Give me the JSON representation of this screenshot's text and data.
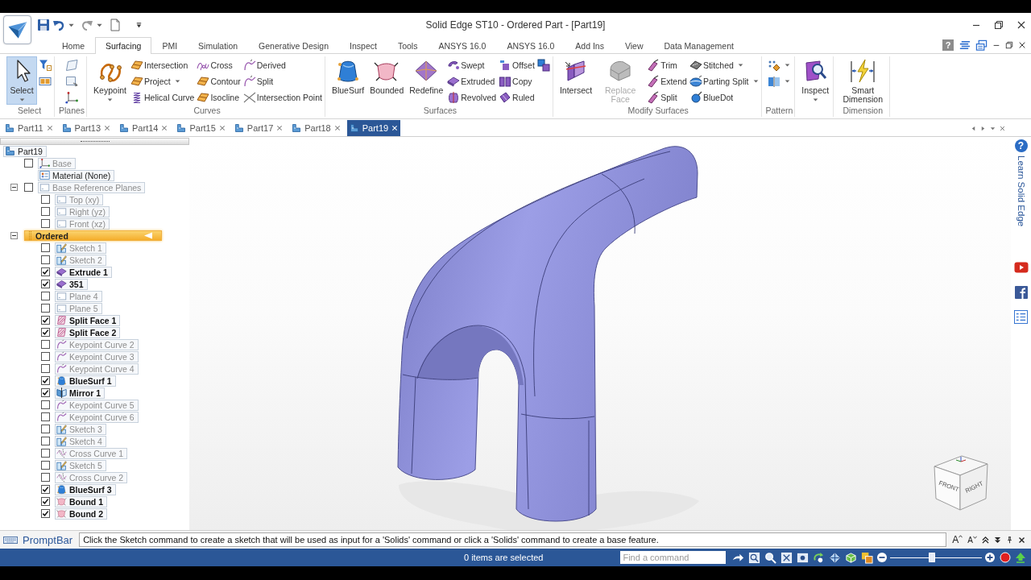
{
  "window": {
    "title": "Solid Edge ST10 - Ordered Part - [Part19]"
  },
  "ribbon": {
    "tabs": [
      {
        "label": "Home",
        "selected": false
      },
      {
        "label": "Surfacing",
        "selected": true
      },
      {
        "label": "PMI",
        "selected": false
      },
      {
        "label": "Simulation",
        "selected": false
      },
      {
        "label": "Generative Design",
        "selected": false
      },
      {
        "label": "Inspect",
        "selected": false
      },
      {
        "label": "Tools",
        "selected": false
      },
      {
        "label": "ANSYS 16.0",
        "selected": false
      },
      {
        "label": "ANSYS 16.0",
        "selected": false
      },
      {
        "label": "Add Ins",
        "selected": false
      },
      {
        "label": "View",
        "selected": false
      },
      {
        "label": "Data Management",
        "selected": false
      }
    ],
    "help_button": "?",
    "groups": [
      {
        "label": "Select",
        "large": [
          {
            "label": "Select",
            "pressed": true,
            "disabled": false,
            "dropdown": true
          }
        ],
        "columns": [
          [
            {
              "dropdown": false
            },
            {
              "dropdown": false
            }
          ]
        ]
      },
      {
        "label": "Planes",
        "columns": [
          [
            {
              "dropdown": false
            },
            {
              "dropdown": false
            },
            {
              "dropdown": false
            }
          ]
        ]
      },
      {
        "label": "Curves",
        "large": [
          {
            "label": "Keypoint",
            "pressed": false,
            "disabled": false,
            "dropdown": true
          }
        ],
        "columns": [
          [
            {
              "label": "Intersection",
              "dropdown": false
            },
            {
              "label": "Project",
              "dropdown": true
            },
            {
              "label": "Helical Curve",
              "dropdown": false
            }
          ],
          [
            {
              "label": "Cross",
              "dropdown": false
            },
            {
              "label": "Contour",
              "dropdown": false
            },
            {
              "label": "Isocline",
              "dropdown": false
            }
          ],
          [
            {
              "label": "Derived",
              "dropdown": false
            },
            {
              "label": "Split",
              "dropdown": false
            },
            {
              "label": "Intersection Point",
              "dropdown": false
            }
          ]
        ]
      },
      {
        "label": "Surfaces",
        "large": [
          {
            "label": "BlueSurf",
            "pressed": false,
            "disabled": false,
            "dropdown": false
          },
          {
            "label": "Bounded",
            "pressed": false,
            "disabled": false,
            "dropdown": false
          },
          {
            "label": "Redefine",
            "pressed": false,
            "disabled": false,
            "dropdown": false
          }
        ],
        "columns": [
          [
            {
              "label": "Swept",
              "dropdown": false
            },
            {
              "label": "Extruded",
              "dropdown": false
            },
            {
              "label": "Revolved",
              "dropdown": false
            }
          ],
          [
            {
              "label": "Offset",
              "dropdown": false
            },
            {
              "label": "Copy",
              "dropdown": false
            },
            {
              "label": "Ruled",
              "dropdown": false
            }
          ],
          [
            {
              "dropdown": false
            }
          ]
        ]
      },
      {
        "label": "Modify Surfaces",
        "large": [
          {
            "label": "Intersect",
            "pressed": false,
            "disabled": false,
            "dropdown": false
          },
          {
            "label": "Replace Face",
            "pressed": false,
            "disabled": true,
            "dropdown": false
          }
        ],
        "columns": [
          [
            {
              "label": "Trim",
              "dropdown": false
            },
            {
              "label": "Extend",
              "dropdown": false
            },
            {
              "label": "Split",
              "dropdown": false
            }
          ],
          [
            {
              "label": "Stitched",
              "dropdown": true
            },
            {
              "label": "Parting Split",
              "dropdown": true
            },
            {
              "label": "BlueDot",
              "dropdown": false
            }
          ]
        ]
      },
      {
        "label": "Pattern",
        "columns": [
          [
            {
              "dropdown": true
            },
            {
              "dropdown": true
            }
          ]
        ]
      },
      {
        "large": [
          {
            "label": "Inspect",
            "pressed": false,
            "disabled": false,
            "dropdown": true
          }
        ]
      },
      {
        "label": "Dimension",
        "large": [
          {
            "label": "Smart Dimension",
            "pressed": false,
            "disabled": false,
            "dropdown": false
          }
        ]
      }
    ]
  },
  "documents": {
    "tabs": [
      {
        "label": "Part11",
        "selected": false
      },
      {
        "label": "Part13",
        "selected": false
      },
      {
        "label": "Part14",
        "selected": false
      },
      {
        "label": "Part15",
        "selected": false
      },
      {
        "label": "Part17",
        "selected": false
      },
      {
        "label": "Part18",
        "selected": false
      },
      {
        "label": "Part19",
        "selected": true
      }
    ]
  },
  "feature_tree": {
    "root": {
      "label": "Part19",
      "kind": "part",
      "children": [
        {
          "label": "Base",
          "kind": "base",
          "checked": false
        },
        {
          "label": "Material (None)",
          "kind": "material"
        },
        {
          "label": "Base Reference Planes",
          "kind": "plane",
          "checked": false,
          "expanded": true,
          "children": [
            {
              "label": "Top (xy)",
              "kind": "plane",
              "checked": false
            },
            {
              "label": "Right (yz)",
              "kind": "plane",
              "checked": false
            },
            {
              "label": "Front (xz)",
              "kind": "plane",
              "checked": false
            }
          ]
        },
        {
          "label": "Ordered",
          "kind": "ordered",
          "expanded": true,
          "children": [
            {
              "label": "Sketch 1",
              "kind": "sketch",
              "checked": false
            },
            {
              "label": "Sketch 2",
              "kind": "sketch",
              "checked": false
            },
            {
              "label": "Extrude 1",
              "kind": "extrude",
              "checked": true
            },
            {
              "label": "351",
              "kind": "extrude",
              "checked": true
            },
            {
              "label": "Plane 4",
              "kind": "plane",
              "checked": false
            },
            {
              "label": "Plane 5",
              "kind": "plane",
              "checked": false
            },
            {
              "label": "Split Face 1",
              "kind": "split",
              "checked": true
            },
            {
              "label": "Split Face 2",
              "kind": "split",
              "checked": true
            },
            {
              "label": "Keypoint Curve 2",
              "kind": "keypoint",
              "checked": false
            },
            {
              "label": "Keypoint Curve 3",
              "kind": "keypoint",
              "checked": false
            },
            {
              "label": "Keypoint Curve 4",
              "kind": "keypoint",
              "checked": false
            },
            {
              "label": "BlueSurf 1",
              "kind": "bluesurf",
              "checked": true
            },
            {
              "label": "Mirror 1",
              "kind": "mirror",
              "checked": true
            },
            {
              "label": "Keypoint Curve 5",
              "kind": "keypoint",
              "checked": false
            },
            {
              "label": "Keypoint Curve 6",
              "kind": "keypoint",
              "checked": false
            },
            {
              "label": "Sketch 3",
              "kind": "sketch",
              "checked": false
            },
            {
              "label": "Sketch 4",
              "kind": "sketch",
              "checked": false
            },
            {
              "label": "Cross Curve 1",
              "kind": "cross",
              "checked": false
            },
            {
              "label": "Sketch 5",
              "kind": "sketch",
              "checked": false
            },
            {
              "label": "Cross Curve 2",
              "kind": "cross",
              "checked": false
            },
            {
              "label": "BlueSurf 3",
              "kind": "bluesurf",
              "checked": true
            },
            {
              "label": "Bound 1",
              "kind": "bound",
              "checked": true
            },
            {
              "label": "Bound 2",
              "kind": "bound",
              "checked": true
            }
          ]
        }
      ]
    }
  },
  "viewport": {
    "view_cube": {
      "faces": [
        "FRONT",
        "RIGHT"
      ]
    }
  },
  "side_panel": {
    "help_button": "?",
    "title": "Learn Solid Edge"
  },
  "prompt_bar": {
    "label": "PromptBar",
    "message": "Click the Sketch command to create a sketch that will be used as input for a 'Solids' command or click a 'Solids' command to create a base feature.",
    "tools": [
      {
        "kind": "grow",
        "text": "A"
      },
      {
        "kind": "shrink",
        "text": "A"
      },
      {
        "kind": "up"
      },
      {
        "kind": "down"
      },
      {
        "kind": "pin"
      },
      {
        "kind": "close"
      }
    ]
  },
  "status_bar": {
    "selection": "0 items are selected",
    "search": {
      "placeholder": "Find a command"
    },
    "zoom": {
      "level": 0.45
    }
  }
}
